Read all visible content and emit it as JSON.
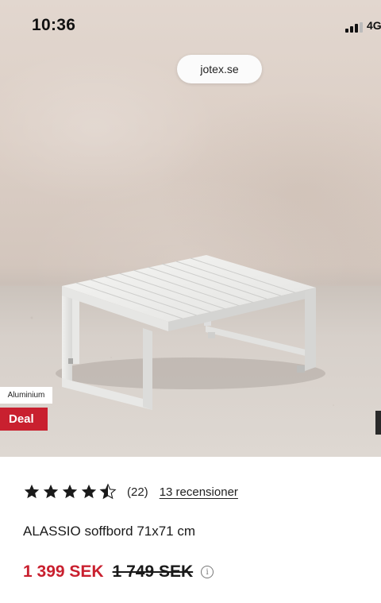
{
  "status_bar": {
    "time": "10:36",
    "network": "4G"
  },
  "browser": {
    "url": "jotex.se"
  },
  "product_image": {
    "badges": {
      "material": "Aluminium",
      "deal": "Deal"
    }
  },
  "product": {
    "rating": 4.5,
    "rating_count": "(22)",
    "reviews_link": "13 recensioner",
    "name": "ALASSIO soffbord 71x71 cm",
    "price_current": "1 399 SEK",
    "price_original": "1 749 SEK",
    "info_icon": "info-icon"
  },
  "colors": {
    "deal_red": "#c9202f",
    "text": "#1a1a1a"
  }
}
